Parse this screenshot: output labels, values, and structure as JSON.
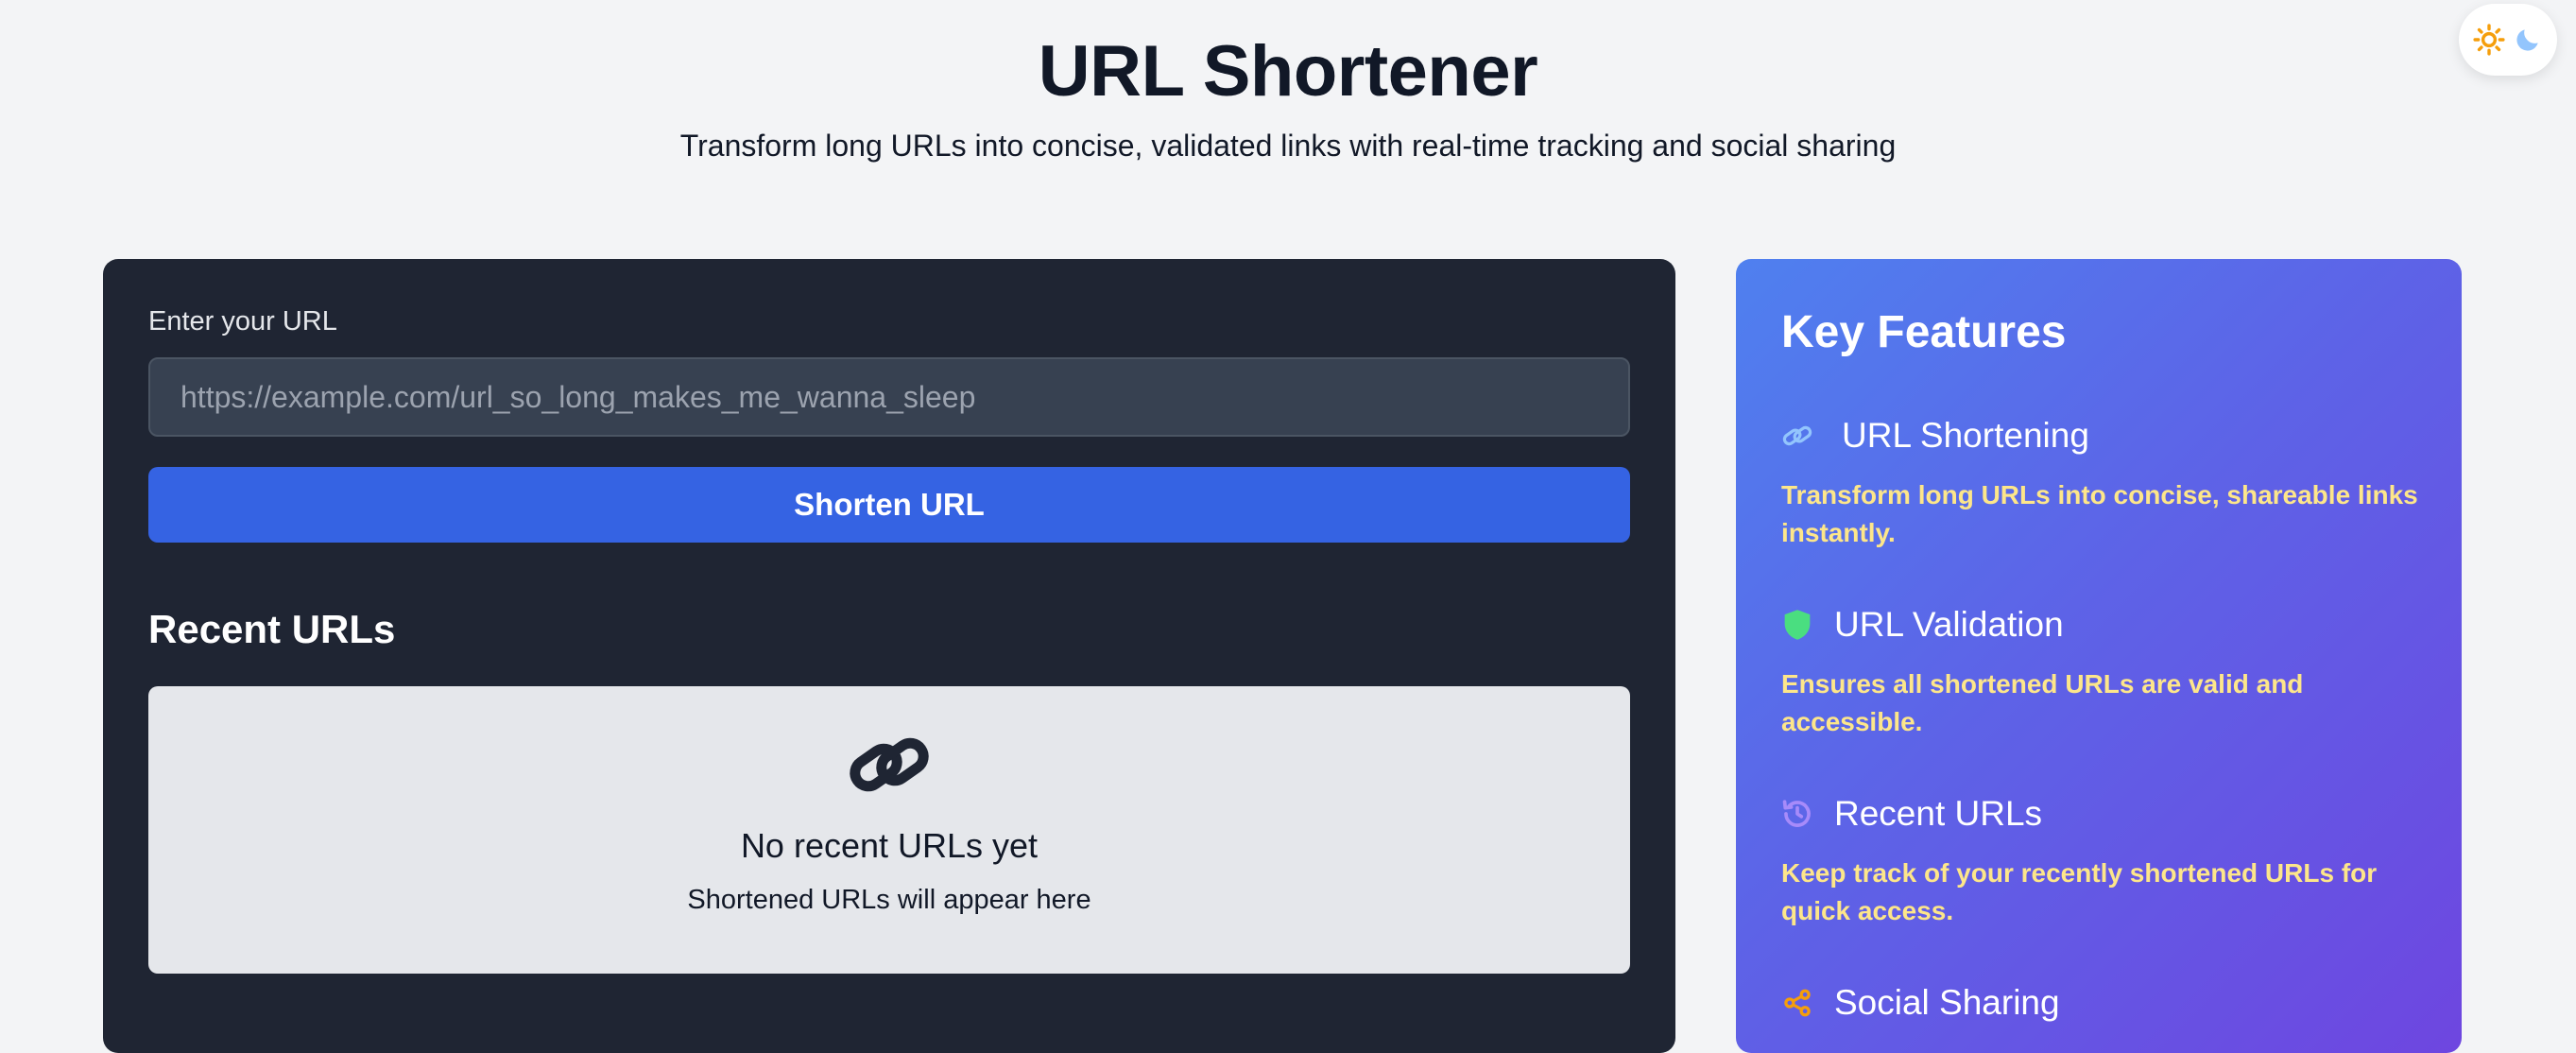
{
  "header": {
    "title": "URL Shortener",
    "subtitle": "Transform long URLs into concise, validated links with real-time tracking and social sharing"
  },
  "theme_toggle": {
    "icons": [
      "sun-icon",
      "moon-icon"
    ],
    "sun_color": "#f59e0b",
    "moon_color": "#93c5fd"
  },
  "form": {
    "label": "Enter your URL",
    "placeholder": "https://example.com/url_so_long_makes_me_wanna_sleep",
    "value": "",
    "button_label": "Shorten URL"
  },
  "recent": {
    "heading": "Recent URLs",
    "empty_icon": "link-icon",
    "empty_title": "No recent URLs yet",
    "empty_subtitle": "Shortened URLs will appear here"
  },
  "features": {
    "title": "Key Features",
    "items": [
      {
        "icon": "link-icon",
        "icon_color": "#93c5fd",
        "name": "URL Shortening",
        "description": "Transform long URLs into concise, shareable links instantly."
      },
      {
        "icon": "shield-icon",
        "icon_color": "#4ade80",
        "name": "URL Validation",
        "description": "Ensures all shortened URLs are valid and accessible."
      },
      {
        "icon": "history-icon",
        "icon_color": "#a78bfa",
        "name": "Recent URLs",
        "description": "Keep track of your recently shortened URLs for quick access."
      },
      {
        "icon": "share-icon",
        "icon_color": "#f59e0b",
        "name": "Social Sharing",
        "description": ""
      }
    ]
  },
  "colors": {
    "page_background": "#f3f4f6",
    "card_background": "#1f2533",
    "accent": "#3563e3",
    "feature_description": "#fde68a"
  }
}
